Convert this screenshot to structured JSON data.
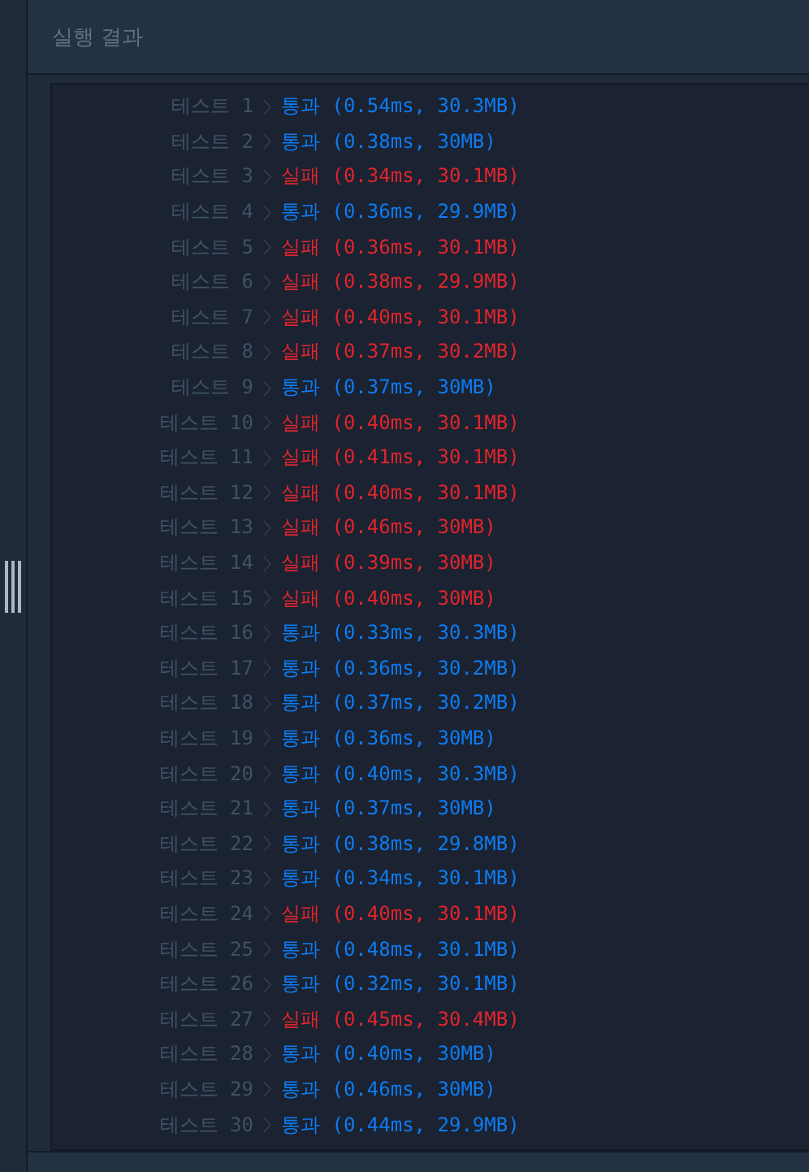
{
  "panel": {
    "title": "실행 결과"
  },
  "results": [
    {
      "label": "테스트 1",
      "passed": true,
      "text": "통과 (0.54ms, 30.3MB)"
    },
    {
      "label": "테스트 2",
      "passed": true,
      "text": "통과 (0.38ms, 30MB)"
    },
    {
      "label": "테스트 3",
      "passed": false,
      "text": "실패 (0.34ms, 30.1MB)"
    },
    {
      "label": "테스트 4",
      "passed": true,
      "text": "통과 (0.36ms, 29.9MB)"
    },
    {
      "label": "테스트 5",
      "passed": false,
      "text": "실패 (0.36ms, 30.1MB)"
    },
    {
      "label": "테스트 6",
      "passed": false,
      "text": "실패 (0.38ms, 29.9MB)"
    },
    {
      "label": "테스트 7",
      "passed": false,
      "text": "실패 (0.40ms, 30.1MB)"
    },
    {
      "label": "테스트 8",
      "passed": false,
      "text": "실패 (0.37ms, 30.2MB)"
    },
    {
      "label": "테스트 9",
      "passed": true,
      "text": "통과 (0.37ms, 30MB)"
    },
    {
      "label": "테스트 10",
      "passed": false,
      "text": "실패 (0.40ms, 30.1MB)"
    },
    {
      "label": "테스트 11",
      "passed": false,
      "text": "실패 (0.41ms, 30.1MB)"
    },
    {
      "label": "테스트 12",
      "passed": false,
      "text": "실패 (0.40ms, 30.1MB)"
    },
    {
      "label": "테스트 13",
      "passed": false,
      "text": "실패 (0.46ms, 30MB)"
    },
    {
      "label": "테스트 14",
      "passed": false,
      "text": "실패 (0.39ms, 30MB)"
    },
    {
      "label": "테스트 15",
      "passed": false,
      "text": "실패 (0.40ms, 30MB)"
    },
    {
      "label": "테스트 16",
      "passed": true,
      "text": "통과 (0.33ms, 30.3MB)"
    },
    {
      "label": "테스트 17",
      "passed": true,
      "text": "통과 (0.36ms, 30.2MB)"
    },
    {
      "label": "테스트 18",
      "passed": true,
      "text": "통과 (0.37ms, 30.2MB)"
    },
    {
      "label": "테스트 19",
      "passed": true,
      "text": "통과 (0.36ms, 30MB)"
    },
    {
      "label": "테스트 20",
      "passed": true,
      "text": "통과 (0.40ms, 30.3MB)"
    },
    {
      "label": "테스트 21",
      "passed": true,
      "text": "통과 (0.37ms, 30MB)"
    },
    {
      "label": "테스트 22",
      "passed": true,
      "text": "통과 (0.38ms, 29.8MB)"
    },
    {
      "label": "테스트 23",
      "passed": true,
      "text": "통과 (0.34ms, 30.1MB)"
    },
    {
      "label": "테스트 24",
      "passed": false,
      "text": "실패 (0.40ms, 30.1MB)"
    },
    {
      "label": "테스트 25",
      "passed": true,
      "text": "통과 (0.48ms, 30.1MB)"
    },
    {
      "label": "테스트 26",
      "passed": true,
      "text": "통과 (0.32ms, 30.1MB)"
    },
    {
      "label": "테스트 27",
      "passed": false,
      "text": "실패 (0.45ms, 30.4MB)"
    },
    {
      "label": "테스트 28",
      "passed": true,
      "text": "통과 (0.40ms, 30MB)"
    },
    {
      "label": "테스트 29",
      "passed": true,
      "text": "통과 (0.46ms, 30MB)"
    },
    {
      "label": "테스트 30",
      "passed": true,
      "text": "통과 (0.44ms, 29.9MB)"
    }
  ]
}
